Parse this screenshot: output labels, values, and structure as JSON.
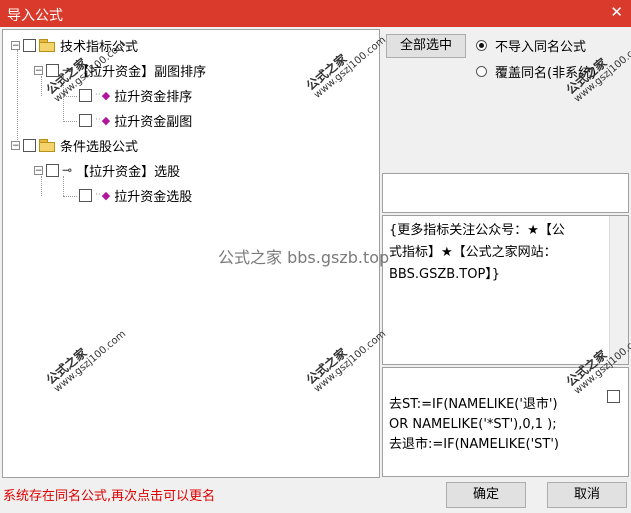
{
  "window": {
    "title": "导入公式",
    "close_icon": "✕",
    "accent": "#d93a2b"
  },
  "tree": {
    "groups": [
      {
        "label": "技术指标公式",
        "sub": {
          "label": "【拉升资金】副图排序",
          "items": [
            "拉升资金排序",
            "拉升资金副图"
          ]
        }
      },
      {
        "label": "条件选股公式",
        "sub": {
          "label": "【拉升资金】选股",
          "items": [
            "拉升资金选股"
          ]
        }
      }
    ]
  },
  "right": {
    "select_all_label": "全部选中",
    "radio_no_import": "不导入同名公式",
    "radio_overwrite": "覆盖同名(非系统)",
    "note_lines": [
      "{更多指标关注公众号：★【公",
      "式指标】★【公式之家网站：",
      "BBS.GSZB.TOP】}"
    ],
    "code_lines": [
      "去ST:=IF(NAMELIKE('退市')",
      "OR NAMELIKE('*ST'),0,1 );",
      "去退市:=IF(NAMELIKE('ST')"
    ]
  },
  "watermark": {
    "brand": "公式之家",
    "site": "www.gszj100.com",
    "center_text": "公式之家 bbs.gszb.top"
  },
  "footer": {
    "status": "系统存在同名公式,再次点击可以更名",
    "ok_label": "确定",
    "cancel_label": "取消"
  }
}
